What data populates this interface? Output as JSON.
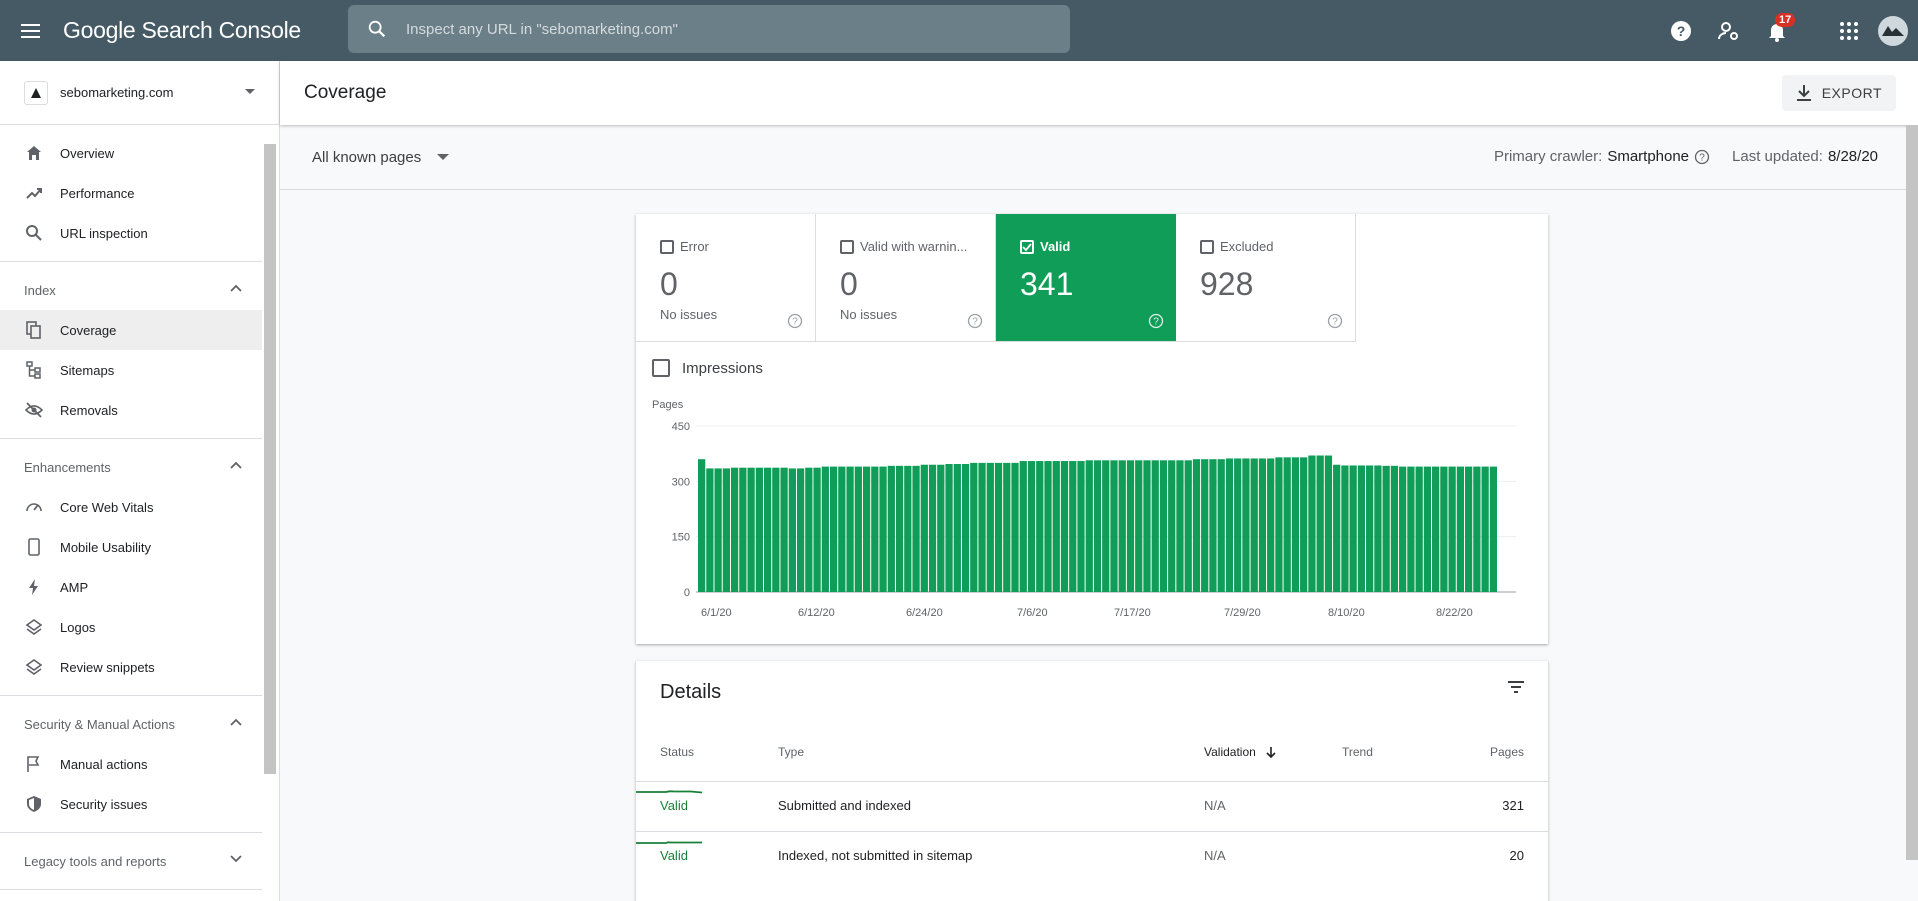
{
  "app": {
    "brand": "Google Search Console",
    "search_placeholder": "Inspect any URL in \"sebomarketing.com\"",
    "notifications_count": "17"
  },
  "sidebar": {
    "property": "sebomarketing.com",
    "top_items": [
      {
        "label": "Overview",
        "icon": "home-icon"
      },
      {
        "label": "Performance",
        "icon": "trending-up-icon"
      },
      {
        "label": "URL inspection",
        "icon": "search-icon"
      }
    ],
    "index": {
      "title": "Index",
      "items": [
        {
          "label": "Coverage",
          "icon": "file-copy-icon",
          "active": true
        },
        {
          "label": "Sitemaps",
          "icon": "sitemap-icon"
        },
        {
          "label": "Removals",
          "icon": "eye-off-icon"
        }
      ]
    },
    "enhancements": {
      "title": "Enhancements",
      "items": [
        {
          "label": "Core Web Vitals",
          "icon": "gauge-icon"
        },
        {
          "label": "Mobile Usability",
          "icon": "phone-icon"
        },
        {
          "label": "AMP",
          "icon": "bolt-icon"
        },
        {
          "label": "Logos",
          "icon": "layers-icon"
        },
        {
          "label": "Review snippets",
          "icon": "layers-icon"
        }
      ]
    },
    "security": {
      "title": "Security & Manual Actions",
      "items": [
        {
          "label": "Manual actions",
          "icon": "flag-icon"
        },
        {
          "label": "Security issues",
          "icon": "shield-icon"
        }
      ]
    },
    "legacy": {
      "title": "Legacy tools and reports"
    }
  },
  "page": {
    "title": "Coverage",
    "export_label": "EXPORT",
    "filter_label": "All known pages",
    "crawler_label": "Primary crawler:",
    "crawler_value": "Smartphone",
    "updated_label": "Last updated:",
    "updated_value": "8/28/20"
  },
  "tiles": [
    {
      "label": "Error",
      "value": "0",
      "sub": "No issues",
      "selected": false
    },
    {
      "label": "Valid with warnin...",
      "value": "0",
      "sub": "No issues",
      "selected": false
    },
    {
      "label": "Valid",
      "value": "341",
      "sub": "",
      "selected": true
    },
    {
      "label": "Excluded",
      "value": "928",
      "sub": "",
      "selected": false
    }
  ],
  "impressions_label": "Impressions",
  "colors": {
    "valid_green": "#0f9d58",
    "topbar": "#455a64"
  },
  "chart_data": {
    "type": "bar",
    "ylabel": "Pages",
    "ylim": [
      0,
      450
    ],
    "yticks": [
      0,
      150,
      300,
      450
    ],
    "xtick_labels": [
      "6/1/20",
      "6/12/20",
      "6/24/20",
      "7/6/20",
      "7/17/20",
      "7/29/20",
      "8/10/20",
      "8/22/20"
    ],
    "values": [
      360,
      335,
      335,
      335,
      337,
      337,
      337,
      337,
      337,
      337,
      337,
      335,
      335,
      337,
      337,
      340,
      340,
      340,
      340,
      340,
      340,
      340,
      340,
      342,
      342,
      342,
      342,
      345,
      345,
      345,
      347,
      347,
      347,
      350,
      350,
      350,
      350,
      350,
      350,
      355,
      355,
      355,
      355,
      355,
      355,
      355,
      355,
      357,
      357,
      357,
      357,
      357,
      357,
      357,
      357,
      357,
      357,
      357,
      357,
      357,
      360,
      360,
      360,
      360,
      362,
      362,
      362,
      362,
      362,
      362,
      365,
      365,
      365,
      365,
      370,
      370,
      370,
      345,
      343,
      343,
      343,
      343,
      343,
      342,
      342,
      340,
      340,
      340,
      340,
      340,
      340,
      340,
      340,
      340,
      340,
      340,
      340
    ]
  },
  "details": {
    "title": "Details",
    "columns": {
      "status": "Status",
      "type": "Type",
      "validation": "Validation",
      "trend": "Trend",
      "pages": "Pages"
    },
    "rows": [
      {
        "status": "Valid",
        "type": "Submitted and indexed",
        "validation": "N/A",
        "pages": "321"
      },
      {
        "status": "Valid",
        "type": "Indexed, not submitted in sitemap",
        "validation": "N/A",
        "pages": "20"
      }
    ]
  }
}
